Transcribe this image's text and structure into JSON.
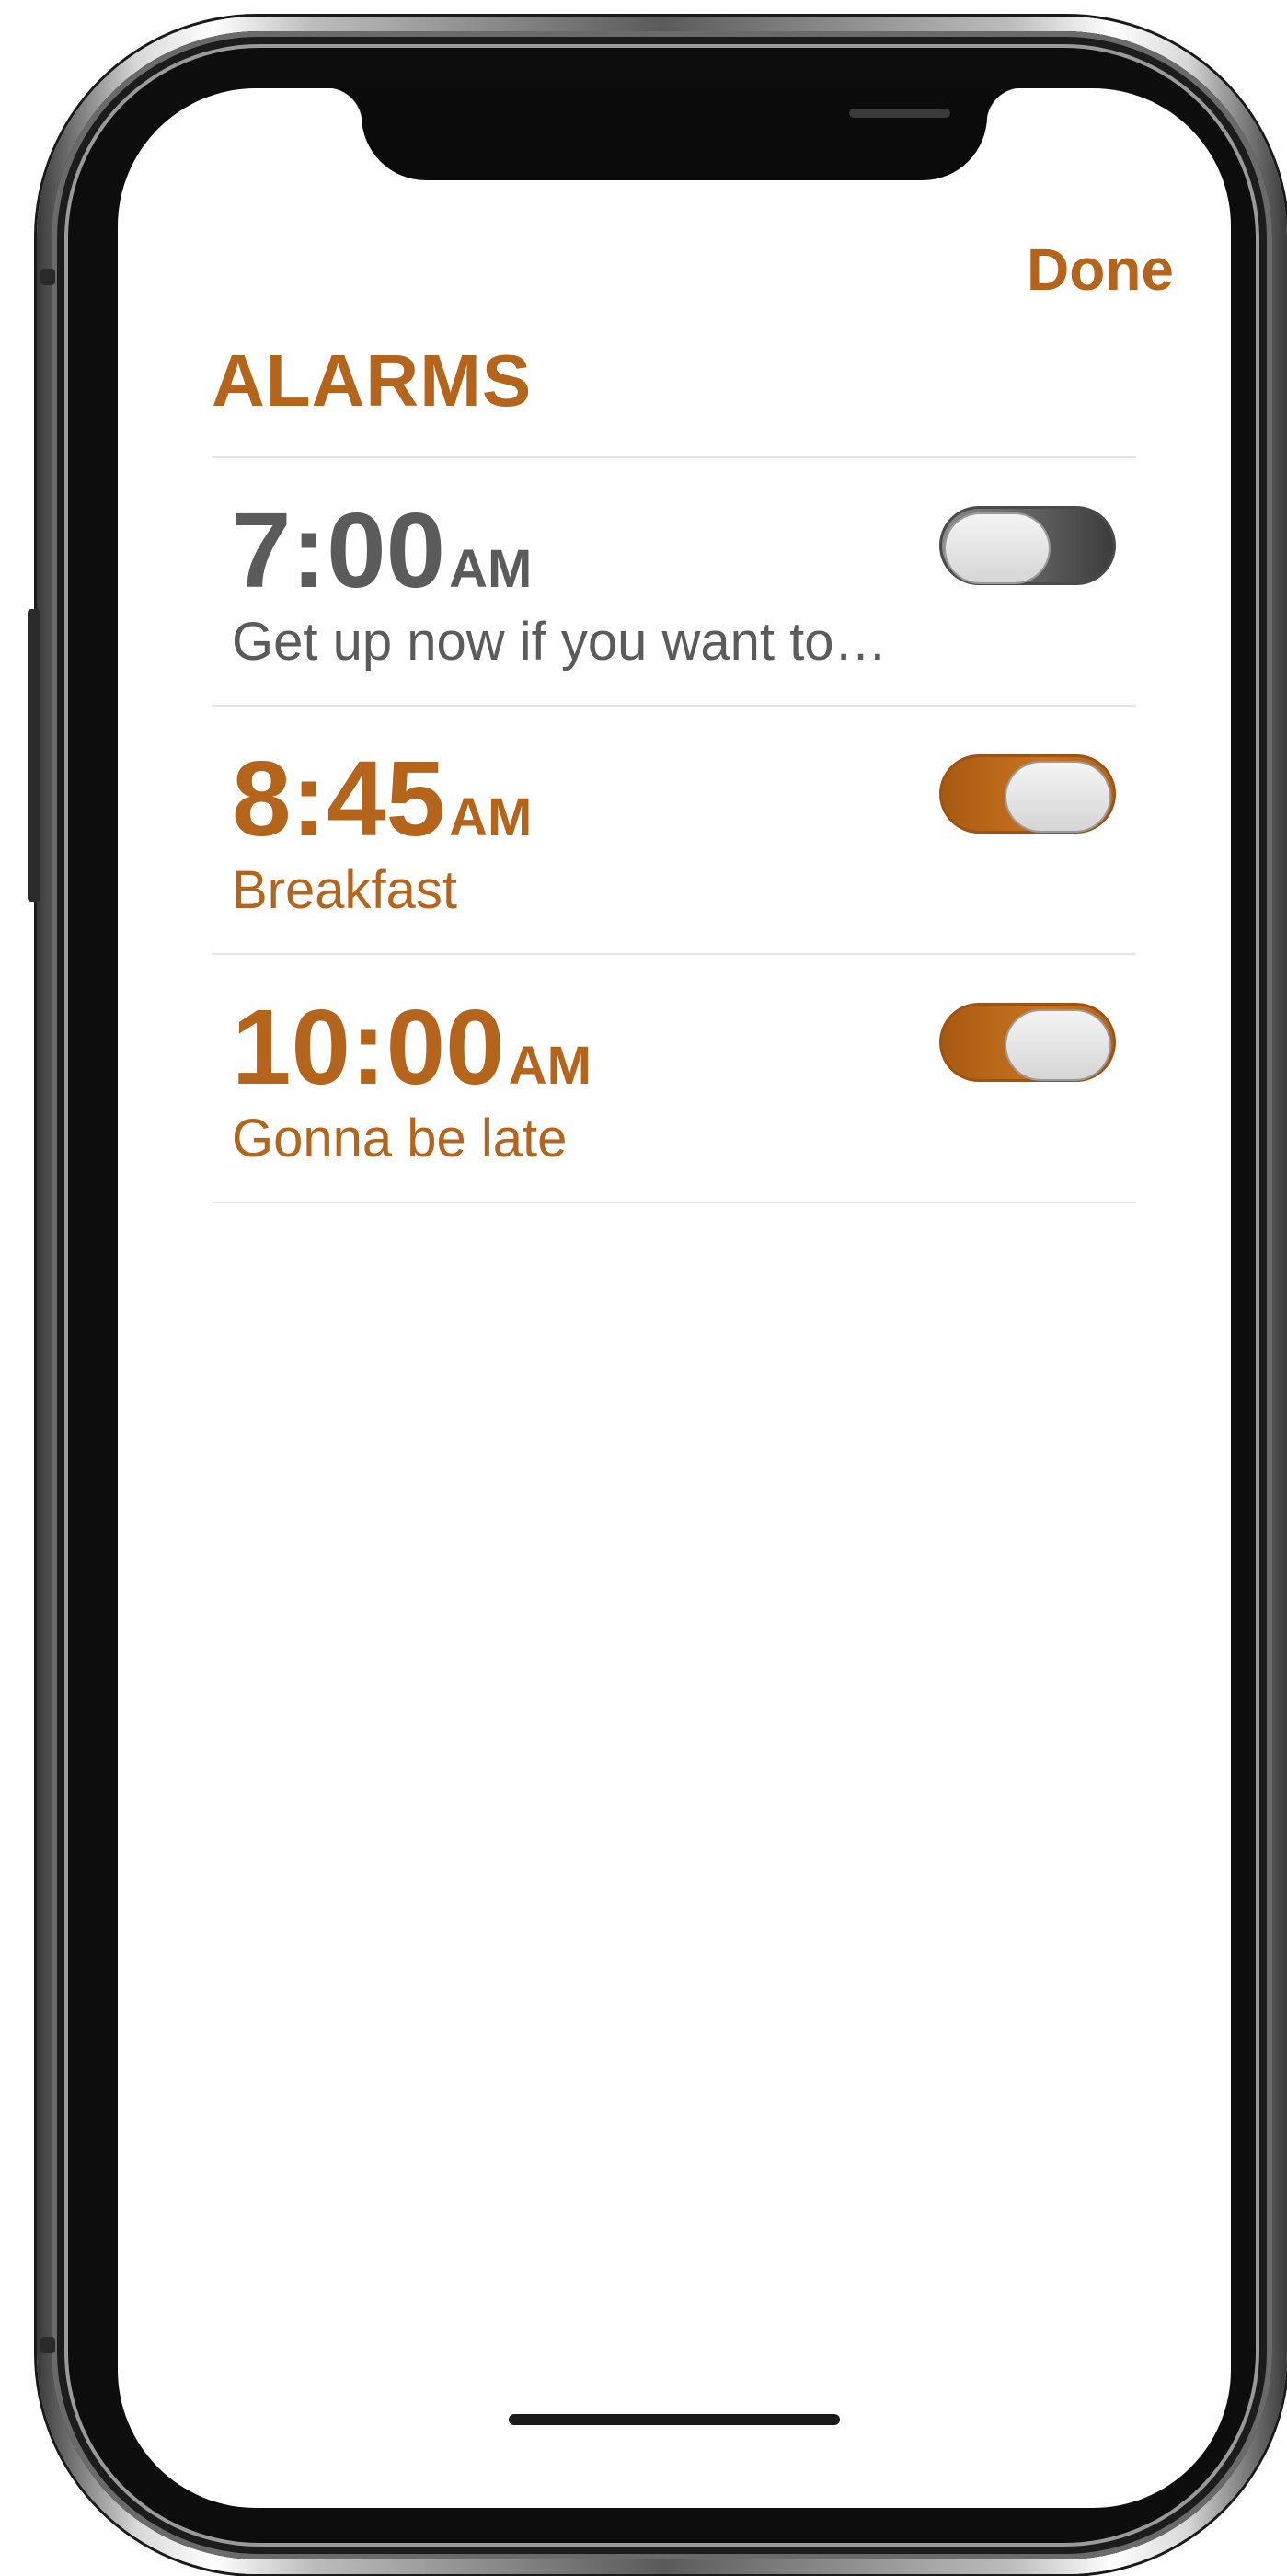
{
  "header": {
    "done_label": "Done",
    "section_title": "ALARMS"
  },
  "colors": {
    "accent": "#b5641c",
    "inactive_text": "#5b5b5b",
    "divider": "#e6e6e6"
  },
  "alarms": [
    {
      "time": "7:00",
      "period": "AM",
      "label": "Get up now if you want to…",
      "enabled": false
    },
    {
      "time": "8:45",
      "period": "AM",
      "label": "Breakfast",
      "enabled": true
    },
    {
      "time": "10:00",
      "period": "AM",
      "label": "Gonna be late",
      "enabled": true
    }
  ]
}
